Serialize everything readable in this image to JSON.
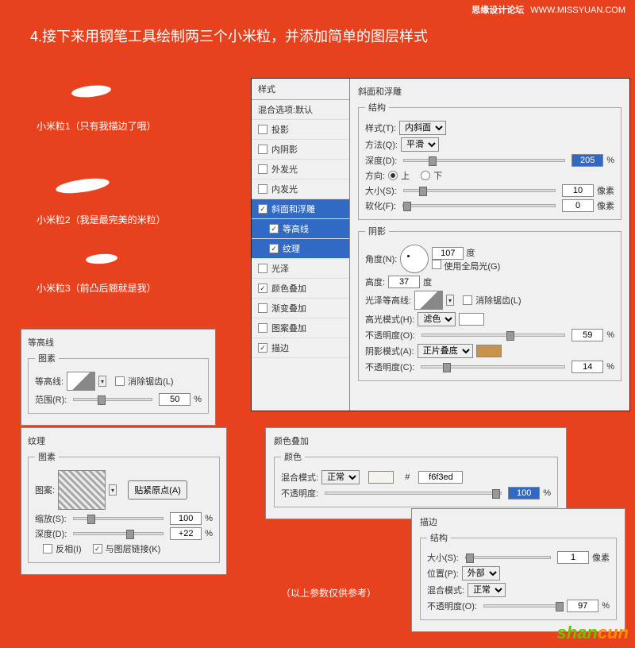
{
  "watermark": {
    "site": "思缘设计论坛",
    "url": "WWW.MISSYUAN.COM"
  },
  "title": "4.接下来用钢笔工具绘制两三个小米粒，并添加简单的图层样式",
  "rice": {
    "r1": "小米粒1（只有我描边了哦）",
    "r2": "小米粒2（我是最完美的米粒）",
    "r3": "小米粒3（前凸后翘就是我）"
  },
  "styles": {
    "header": "样式",
    "blend_defaults": "混合选项:默认",
    "drop_shadow": "投影",
    "inner_shadow": "内阴影",
    "outer_glow": "外发光",
    "inner_glow": "内发光",
    "bevel_emboss": "斜面和浮雕",
    "contour": "等高线",
    "texture": "纹理",
    "satin": "光泽",
    "color_overlay": "颜色叠加",
    "gradient_overlay": "渐变叠加",
    "pattern_overlay": "图案叠加",
    "stroke": "描边"
  },
  "bevel": {
    "title": "斜面和浮雕",
    "structure": "结构",
    "style_label": "样式(T):",
    "style_val": "内斜面",
    "technique_label": "方法(Q):",
    "technique_val": "平滑",
    "depth_label": "深度(D):",
    "depth_val": "205",
    "direction_label": "方向:",
    "dir_up": "上",
    "dir_down": "下",
    "size_label": "大小(S):",
    "size_val": "10",
    "px": "像素",
    "soften_label": "软化(F):",
    "soften_val": "0",
    "shading": "阴影",
    "angle_label": "角度(N):",
    "angle_val": "107",
    "deg": "度",
    "global_light": "使用全局光(G)",
    "altitude_label": "高度:",
    "altitude_val": "37",
    "gloss_contour": "光泽等高线:",
    "antialias": "消除锯齿(L)",
    "highlight_mode": "高光模式(H):",
    "highlight_mode_val": "滤色",
    "opacity_label": "不透明度(O):",
    "highlight_opacity": "59",
    "pct": "%",
    "shadow_mode": "阴影模式(A):",
    "shadow_mode_val": "正片叠底",
    "shadow_opacity_label": "不透明度(C):",
    "shadow_opacity": "14"
  },
  "contour_panel": {
    "title": "等高线",
    "elements": "图素",
    "contour_label": "等高线:",
    "antialias": "消除锯齿(L)",
    "range_label": "范围(R):",
    "range_val": "50",
    "pct": "%"
  },
  "texture_panel": {
    "title": "纹理",
    "elements": "图素",
    "pattern_label": "图案:",
    "snap": "贴紧原点(A)",
    "scale_label": "缩放(S):",
    "scale_val": "100",
    "depth_label": "深度(D):",
    "depth_val": "+22",
    "invert": "反相(I)",
    "link": "与图层链接(K)",
    "pct": "%"
  },
  "color_overlay": {
    "title": "颜色叠加",
    "color": "颜色",
    "blend_mode": "混合模式:",
    "blend_val": "正常",
    "hex_prefix": "#",
    "hex": "f6f3ed",
    "opacity_label": "不透明度:",
    "opacity_val": "100",
    "pct": "%"
  },
  "stroke": {
    "title": "描边",
    "structure": "结构",
    "size_label": "大小(S):",
    "size_val": "1",
    "px": "像素",
    "position_label": "位置(P):",
    "position_val": "外部",
    "blend_label": "混合模式:",
    "blend_val": "正常",
    "opacity_label": "不透明度(O):",
    "opacity_val": "97",
    "pct": "%"
  },
  "note": "（以上参数仅供参考）"
}
